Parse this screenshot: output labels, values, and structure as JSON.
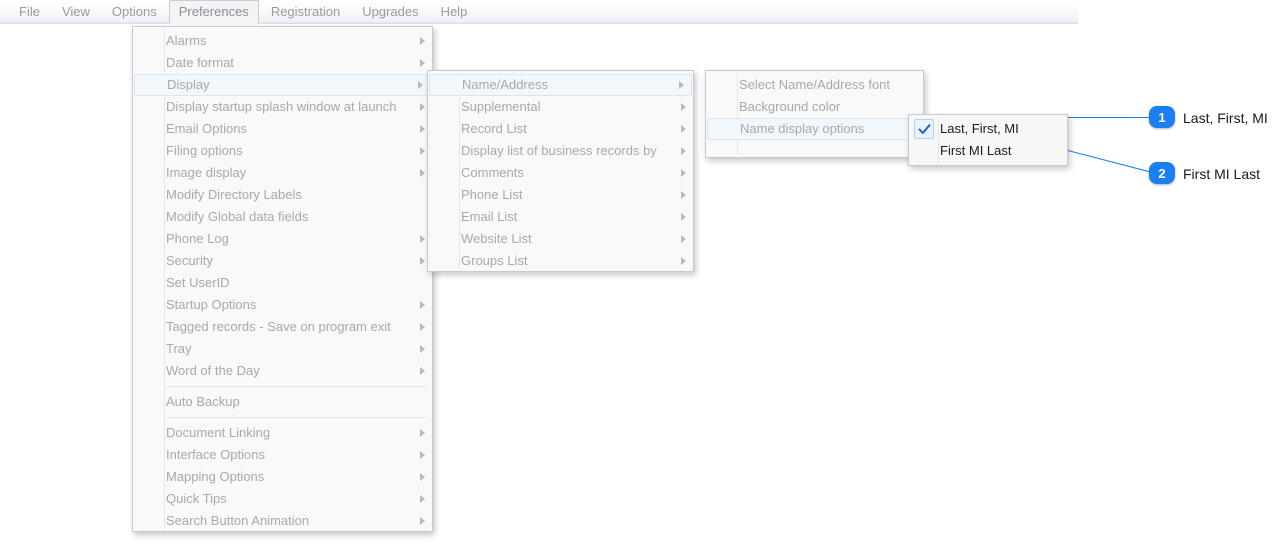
{
  "menubar": {
    "items": [
      {
        "label": "File",
        "active": false
      },
      {
        "label": "View",
        "active": false
      },
      {
        "label": "Options",
        "active": false
      },
      {
        "label": "Preferences",
        "active": true
      },
      {
        "label": "Registration",
        "active": false
      },
      {
        "label": "Upgrades",
        "active": false
      },
      {
        "label": "Help",
        "active": false
      }
    ]
  },
  "menus": {
    "preferences": {
      "name": "preferences-menu",
      "items": [
        {
          "label": "Alarms",
          "submenu": true,
          "highlighted": false,
          "type": "item"
        },
        {
          "label": "Date format",
          "submenu": true,
          "highlighted": false,
          "type": "item"
        },
        {
          "label": "Display",
          "submenu": true,
          "highlighted": true,
          "type": "item"
        },
        {
          "label": "Display startup splash window at launch",
          "submenu": true,
          "highlighted": false,
          "type": "item"
        },
        {
          "label": "Email Options",
          "submenu": true,
          "highlighted": false,
          "type": "item"
        },
        {
          "label": "Filing options",
          "submenu": true,
          "highlighted": false,
          "type": "item"
        },
        {
          "label": "Image display",
          "submenu": true,
          "highlighted": false,
          "type": "item"
        },
        {
          "label": "Modify Directory Labels",
          "submenu": false,
          "highlighted": false,
          "type": "item"
        },
        {
          "label": "Modify Global data fields",
          "submenu": false,
          "highlighted": false,
          "type": "item"
        },
        {
          "label": "Phone Log",
          "submenu": true,
          "highlighted": false,
          "type": "item"
        },
        {
          "label": "Security",
          "submenu": true,
          "highlighted": false,
          "type": "item"
        },
        {
          "label": "Set UserID",
          "submenu": false,
          "highlighted": false,
          "type": "item"
        },
        {
          "label": "Startup Options",
          "submenu": true,
          "highlighted": false,
          "type": "item"
        },
        {
          "label": "Tagged records - Save on program exit",
          "submenu": true,
          "highlighted": false,
          "type": "item"
        },
        {
          "label": "Tray",
          "submenu": true,
          "highlighted": false,
          "type": "item"
        },
        {
          "label": "Word of the Day",
          "submenu": true,
          "highlighted": false,
          "type": "item"
        },
        {
          "label": "",
          "submenu": false,
          "highlighted": false,
          "type": "separator"
        },
        {
          "label": "Auto Backup",
          "submenu": false,
          "highlighted": false,
          "type": "item"
        },
        {
          "label": "",
          "submenu": false,
          "highlighted": false,
          "type": "separator"
        },
        {
          "label": "Document Linking",
          "submenu": true,
          "highlighted": false,
          "type": "item"
        },
        {
          "label": "Interface Options",
          "submenu": true,
          "highlighted": false,
          "type": "item"
        },
        {
          "label": "Mapping Options",
          "submenu": true,
          "highlighted": false,
          "type": "item"
        },
        {
          "label": "Quick Tips",
          "submenu": true,
          "highlighted": false,
          "type": "item"
        },
        {
          "label": "Search Button Animation",
          "submenu": true,
          "highlighted": false,
          "type": "item"
        }
      ]
    },
    "display": {
      "name": "display-submenu",
      "items": [
        {
          "label": "Name/Address",
          "submenu": true,
          "highlighted": true,
          "type": "item"
        },
        {
          "label": "Supplemental",
          "submenu": true,
          "highlighted": false,
          "type": "item"
        },
        {
          "label": "Record List",
          "submenu": true,
          "highlighted": false,
          "type": "item"
        },
        {
          "label": "Display list of business records by",
          "submenu": true,
          "highlighted": false,
          "type": "item"
        },
        {
          "label": "Comments",
          "submenu": true,
          "highlighted": false,
          "type": "item"
        },
        {
          "label": "Phone List",
          "submenu": true,
          "highlighted": false,
          "type": "item"
        },
        {
          "label": "Email List",
          "submenu": true,
          "highlighted": false,
          "type": "item"
        },
        {
          "label": "Website List",
          "submenu": true,
          "highlighted": false,
          "type": "item"
        },
        {
          "label": "Groups List",
          "submenu": true,
          "highlighted": false,
          "type": "item"
        }
      ]
    },
    "name_address": {
      "name": "name-address-submenu",
      "items": [
        {
          "label": "Select Name/Address font",
          "submenu": false,
          "highlighted": false,
          "type": "item"
        },
        {
          "label": "Background color",
          "submenu": false,
          "highlighted": false,
          "type": "item"
        },
        {
          "label": "Name display options",
          "submenu": true,
          "highlighted": true,
          "type": "item"
        }
      ]
    },
    "name_display_options": {
      "name": "name-display-options-submenu",
      "items": [
        {
          "label": "Last, First, MI",
          "submenu": false,
          "highlighted": false,
          "checked": true,
          "type": "item"
        },
        {
          "label": "First MI Last",
          "submenu": false,
          "highlighted": false,
          "checked": false,
          "type": "item"
        }
      ]
    }
  },
  "callouts": {
    "accent_color": "#1a7ff0",
    "items": [
      {
        "number": "1",
        "label": "Last, First, MI"
      },
      {
        "number": "2",
        "label": "First MI Last"
      }
    ]
  }
}
